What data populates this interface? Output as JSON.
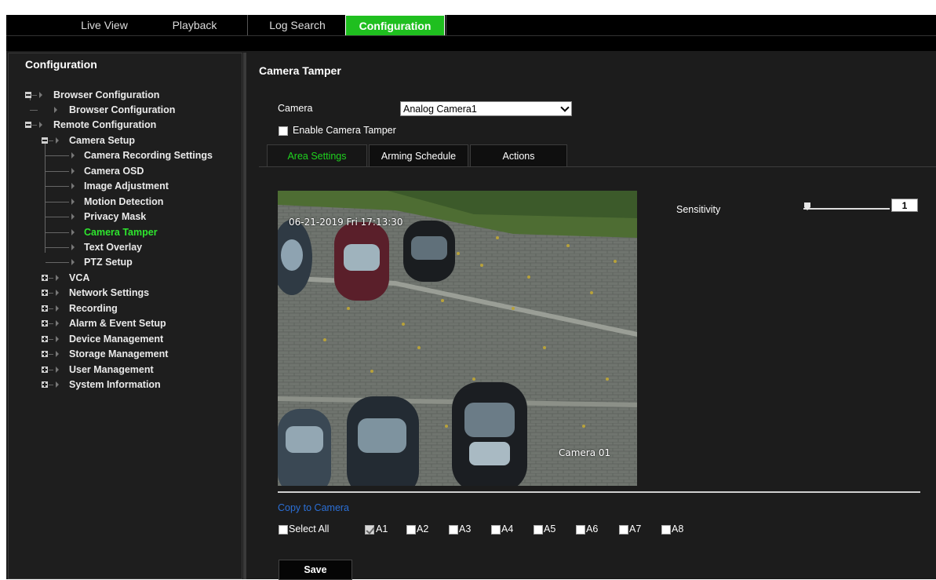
{
  "nav": {
    "tabs": [
      {
        "label": "Live View"
      },
      {
        "label": "Playback"
      },
      {
        "label": "Log Search"
      },
      {
        "label": "Configuration"
      }
    ],
    "active_index": 3
  },
  "sidebar": {
    "title": "Configuration",
    "items": [
      {
        "label": "Browser Configuration"
      },
      {
        "label": "Browser Configuration"
      },
      {
        "label": "Remote Configuration"
      },
      {
        "label": "Camera Setup"
      },
      {
        "label": "Camera Recording Settings"
      },
      {
        "label": "Camera OSD"
      },
      {
        "label": "Image Adjustment"
      },
      {
        "label": "Motion Detection"
      },
      {
        "label": "Privacy Mask"
      },
      {
        "label": "Camera Tamper"
      },
      {
        "label": "Text Overlay"
      },
      {
        "label": "PTZ Setup"
      },
      {
        "label": "VCA"
      },
      {
        "label": "Network Settings"
      },
      {
        "label": "Recording"
      },
      {
        "label": "Alarm & Event Setup"
      },
      {
        "label": "Device Management"
      },
      {
        "label": "Storage Management"
      },
      {
        "label": "User Management"
      },
      {
        "label": "System Information"
      }
    ]
  },
  "main": {
    "title": "Camera Tamper",
    "camera_label": "Camera",
    "camera_value": "Analog Camera1",
    "enable_label": "Enable Camera Tamper",
    "tabs": [
      {
        "label": "Area Settings"
      },
      {
        "label": "Arming Schedule"
      },
      {
        "label": "Actions"
      }
    ],
    "video": {
      "timestamp": "06-21-2019 Fri 17:13:30",
      "camera_name": "Camera 01"
    },
    "sensitivity": {
      "label": "Sensitivity",
      "value": "1"
    },
    "copy": {
      "title": "Copy to Camera",
      "select_all": "Select All",
      "cameras": [
        {
          "label": "A1",
          "checked": true
        },
        {
          "label": "A2",
          "checked": false
        },
        {
          "label": "A3",
          "checked": false
        },
        {
          "label": "A4",
          "checked": false
        },
        {
          "label": "A5",
          "checked": false
        },
        {
          "label": "A6",
          "checked": false
        },
        {
          "label": "A7",
          "checked": false
        },
        {
          "label": "A8",
          "checked": false
        }
      ]
    },
    "save_label": "Save"
  },
  "colors": {
    "accent_green": "#1fbf1f",
    "link_blue": "#2b6fd6",
    "background": "#1c1c1c"
  }
}
